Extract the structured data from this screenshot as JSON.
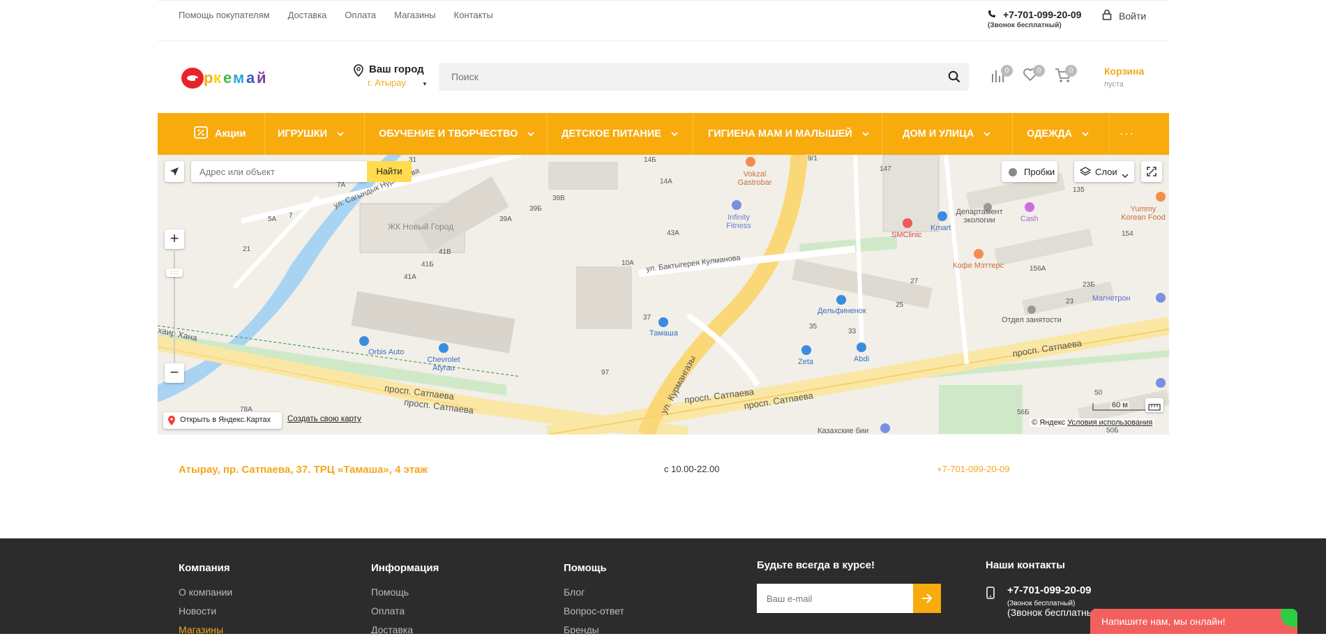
{
  "topbar": {
    "links": [
      "Помощь покупателям",
      "Доставка",
      "Оплата",
      "Магазины",
      "Контакты"
    ],
    "phone": "+7-701-099-20-09",
    "phone_note": "(Звонок бесплатный)",
    "login": "Войти"
  },
  "header": {
    "logo_text": "Еркемай",
    "city_label": "Ваш город",
    "city_value": "г. Атырау",
    "search_placeholder": "Поиск",
    "compare_count": "0",
    "favorites_count": "0",
    "cart_count": "0",
    "cart_title": "Корзина",
    "cart_status": "пуста"
  },
  "nav": {
    "items": [
      "Акции",
      "ИГРУШКИ",
      "ОБУЧЕНИЕ И ТВОРЧЕСТВО",
      "ДЕТСКОЕ ПИТАНИЕ",
      "ГИГИЕНА МАМ И МАЛЫШЕЙ",
      "ДОМ И УЛИЦА",
      "ОДЕЖДА"
    ],
    "more": "· · ·"
  },
  "map": {
    "address_placeholder": "Адрес или объект",
    "find_button": "Найти",
    "traffic": "Пробки",
    "layers": "Слои",
    "zoom_in": "+",
    "zoom_out": "−",
    "open_yandex": "Открыть в Яндекс.Картах",
    "create_map": "Создать свою карту",
    "copyright": "© Яндекс",
    "terms": "Условия использования",
    "scale": "60 м",
    "labels": {
      "sagyndyk": "ул. Сагындык Нургалиева",
      "novy_gorod": "ЖК Новый Город",
      "kulmanova": "ул. Бактыгерея Кулманова",
      "satpaeva1": "просп. Сатпаева",
      "satpaeva2": "просп. Сатпаева",
      "satpaeva3": "просп. Сатпаева",
      "satpaeva4": "просп. Сатпаева",
      "satpaeva5": "просп. Сатпаева",
      "kurmangazy": "ул. Курмангазы",
      "khair_khana": "хаир Хана",
      "vokzal": "Vokzal Gastrobar",
      "infinity": "Infinity Fitness",
      "tamasha": "Тамаша",
      "orbis": "Orbis Auto",
      "chevrolet": "Chevrolet Atyrau",
      "delfinenok": "Дельфиненок",
      "zeta": "Zeta",
      "abdi": "Abdi",
      "kmart": "Kmart",
      "smclinic": "SMClinic",
      "cash": "Cash",
      "departament": "Департамент экологии",
      "kofe": "Кофе Мэттерс",
      "magnetron": "Магнетрон",
      "otdel": "Отдел занятости",
      "yummy": "Yummy Korean Food",
      "kazakhskie": "Казахские бии",
      "h14b": "14Б",
      "h14a": "14А",
      "h43a": "43А",
      "h10a": "10А",
      "h37": "37",
      "h39a": "39А",
      "h39b": "39Б",
      "h39v": "39В",
      "h41v": "41В",
      "h41b": "41Б",
      "h41a": "41А",
      "h31": "31",
      "h7a": "7А",
      "h5a": "5А",
      "h7": "7",
      "h21": "21",
      "h97": "97",
      "h78a": "78А",
      "h147": "147",
      "h135": "135",
      "h154": "154",
      "h156a": "156А",
      "h23b": "23Б",
      "h23": "23",
      "h27": "27",
      "h25": "25",
      "h35": "35",
      "h33": "33",
      "h91": "9/1",
      "h50": "50",
      "h56b": "56Б",
      "h506": "50Б"
    }
  },
  "store": {
    "address": "Атырау, пр. Сатпаева, 37. ТРЦ «Тамаша», 4 этаж",
    "hours": "с 10.00-22.00",
    "phone": "+7-701-099-20-09"
  },
  "footer": {
    "company": {
      "title": "Компания",
      "items": [
        "О компании",
        "Новости",
        "Магазины"
      ]
    },
    "info": {
      "title": "Информация",
      "items": [
        "Помощь",
        "Оплата",
        "Доставка"
      ]
    },
    "help": {
      "title": "Помощь",
      "items": [
        "Блог",
        "Вопрос-ответ",
        "Бренды"
      ]
    },
    "subscribe": {
      "title": "Будьте всегда в курсе!",
      "placeholder": "Ваш e-mail"
    },
    "contacts": {
      "title": "Наши контакты",
      "phone": "+7-701-099-20-09",
      "note_small": "(Звонок бесплатный)",
      "note_big": "(Звонок бесплатный)"
    },
    "chat": "Напишите нам, мы онлайн!"
  },
  "colors": {
    "accent": "#f8ab0c",
    "link_orange": "#f2a81e",
    "footer_bg": "#2c2c2c",
    "chat_red": "#f25f5c"
  }
}
